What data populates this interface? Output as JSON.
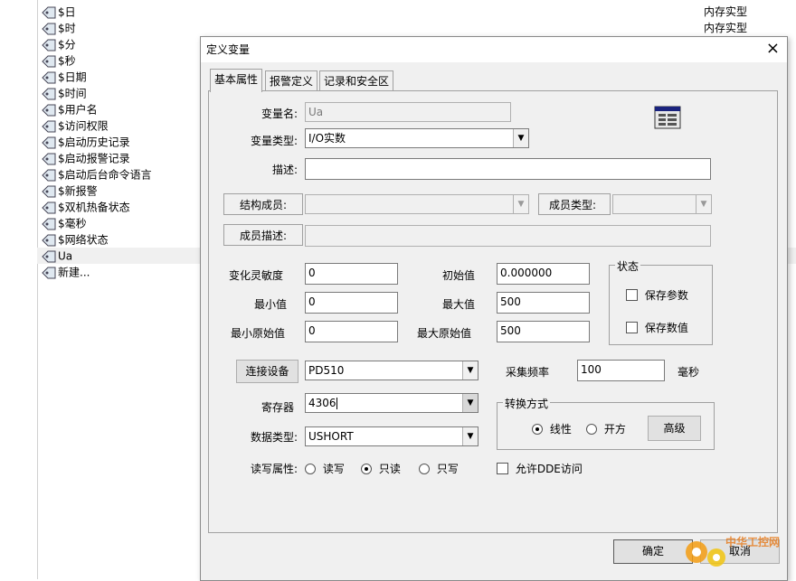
{
  "var_list": [
    {
      "label": "$日",
      "type": "内存实型"
    },
    {
      "label": "$时",
      "type": "内存实型"
    },
    {
      "label": "$分",
      "type": ""
    },
    {
      "label": "$秒",
      "type": ""
    },
    {
      "label": "$日期",
      "type": ""
    },
    {
      "label": "$时间",
      "type": ""
    },
    {
      "label": "$用户名",
      "type": ""
    },
    {
      "label": "$访问权限",
      "type": ""
    },
    {
      "label": "$启动历史记录",
      "type": ""
    },
    {
      "label": "$启动报警记录",
      "type": ""
    },
    {
      "label": "$启动后台命令语言",
      "type": ""
    },
    {
      "label": "$新报警",
      "type": ""
    },
    {
      "label": "$双机热备状态",
      "type": ""
    },
    {
      "label": "$毫秒",
      "type": ""
    },
    {
      "label": "$网络状态",
      "type": ""
    },
    {
      "label": "Ua",
      "type": ""
    },
    {
      "label": "新建...",
      "type": ""
    }
  ],
  "dialog": {
    "title": "定义变量",
    "close": "×",
    "tabs": [
      "基本属性",
      "报警定义",
      "记录和安全区"
    ],
    "labels": {
      "var_name": "变量名:",
      "var_type": "变量类型:",
      "desc": "描述:",
      "struct_member": "结构成员:",
      "member_type": "成员类型:",
      "member_desc": "成员描述:",
      "sensitivity": "变化灵敏度",
      "initial": "初始值",
      "min": "最小值",
      "max": "最大值",
      "min_raw": "最小原始值",
      "max_raw": "最大原始值",
      "state": "状态",
      "save_params": "保存参数",
      "save_values": "保存数值",
      "connect_device": "连接设备",
      "sample_freq": "采集频率",
      "ms": "毫秒",
      "register": "寄存器",
      "convert": "转换方式",
      "linear": "线性",
      "sqrt": "开方",
      "advanced": "高级",
      "data_type": "数据类型:",
      "rw_attr": "读写属性:",
      "rw": "读写",
      "ro": "只读",
      "wo": "只写",
      "allow_dde": "允许DDE访问",
      "ok": "确定",
      "cancel": "取消"
    },
    "values": {
      "var_name": "Ua",
      "var_type": "I/O实数",
      "desc": "",
      "sensitivity": "0",
      "initial": "0.000000",
      "min": "0",
      "max": "500",
      "min_raw": "0",
      "max_raw": "500",
      "device": "PD510",
      "sample_freq": "100",
      "register": "4306",
      "data_type": "USHORT"
    }
  },
  "watermark_text": "中华工控网"
}
